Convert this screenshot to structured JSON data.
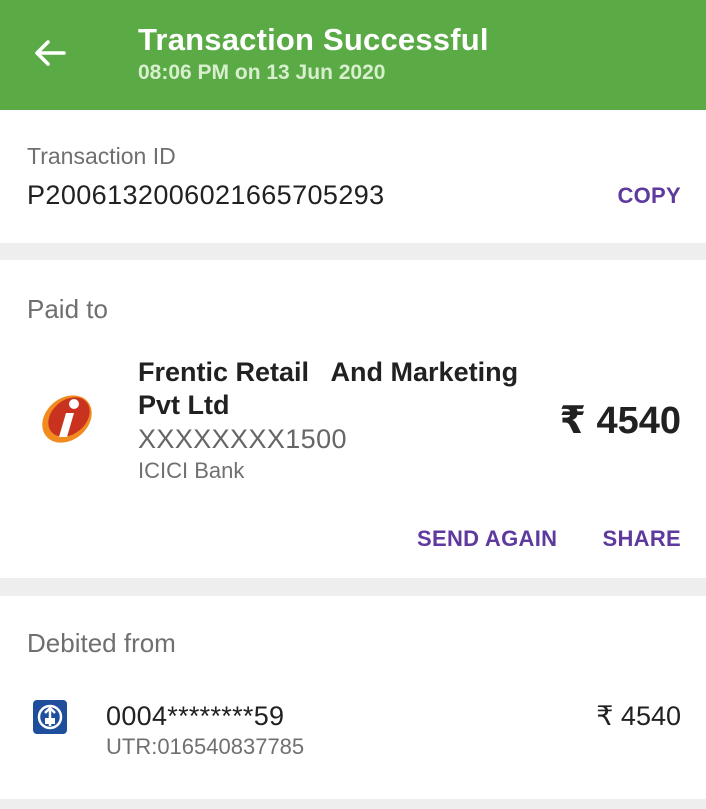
{
  "header": {
    "title": "Transaction Successful",
    "subtitle": "08:06 PM on 13 Jun 2020",
    "color": "#5aaa46"
  },
  "transaction": {
    "label": "Transaction ID",
    "id": "P2006132006021665705293",
    "copy_label": "COPY"
  },
  "paid_to": {
    "label": "Paid to",
    "merchant_name": "Frentic Retail   And Marketing Pvt Ltd",
    "account": "XXXXXXXX1500",
    "bank": "ICICI Bank",
    "amount": "₹ 4540",
    "logo_icon": "icici-bank-logo",
    "send_again_label": "SEND AGAIN",
    "share_label": "SHARE"
  },
  "debited_from": {
    "label": "Debited from",
    "account": "0004********59",
    "utr": "UTR:016540837785",
    "amount": "₹ 4540",
    "bank_icon": "bank-logo"
  },
  "accent_color": "#5f3a9e"
}
